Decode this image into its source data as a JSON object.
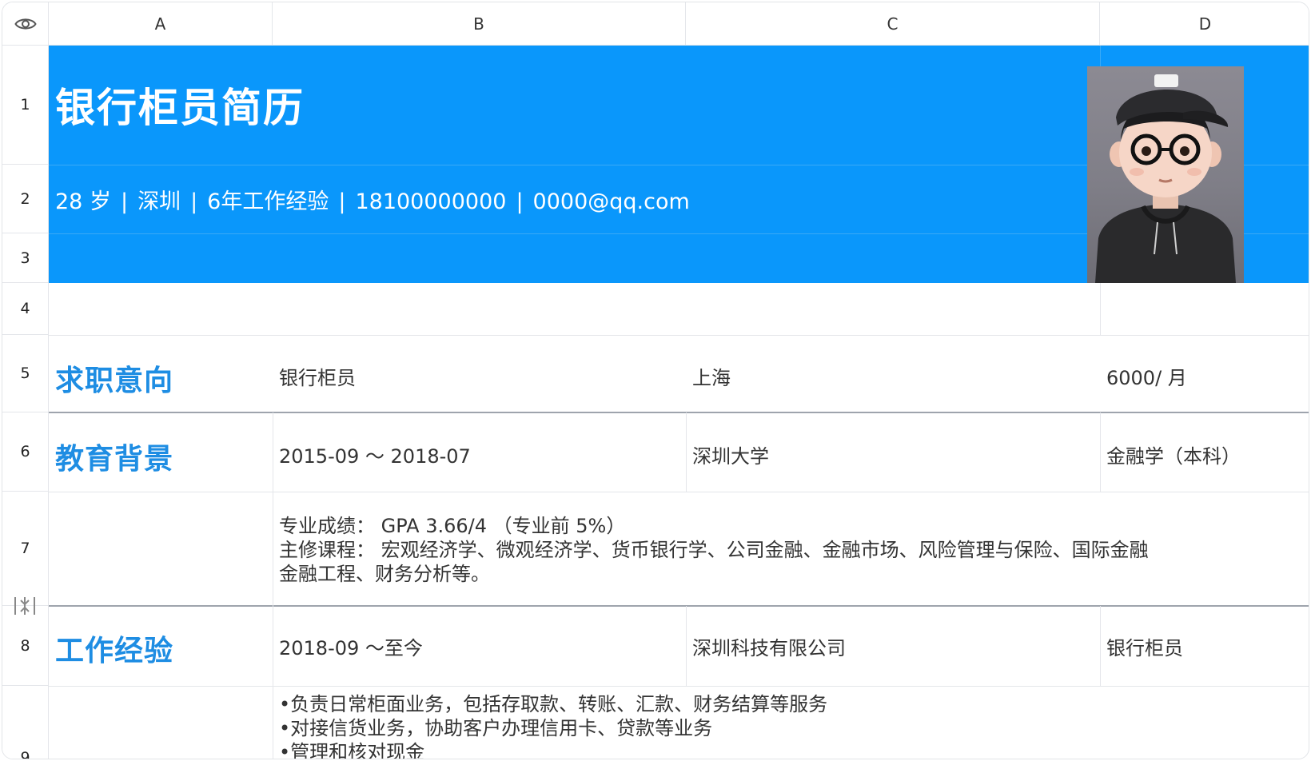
{
  "columns": [
    "A",
    "B",
    "C",
    "D"
  ],
  "rows": [
    "1",
    "2",
    "3",
    "4",
    "5",
    "6",
    "7",
    "8",
    "9"
  ],
  "header": {
    "title": "银行柜员简历",
    "info": [
      "28 岁",
      "深圳",
      "6年工作经验",
      "18100000000",
      "0000@qq.com"
    ],
    "separator": "|"
  },
  "job_intent": {
    "label": "求职意向",
    "position": "银行柜员",
    "city": "上海",
    "salary": "6000/ 月"
  },
  "education": {
    "label": "教育背景",
    "period": "2015-09 ～ 2018-07",
    "school": "深圳大学",
    "major": "金融学（本科）",
    "details": [
      "专业成绩： GPA 3.66/4 （专业前 5%）",
      "主修课程： 宏观经济学、微观经济学、货币银行学、公司金融、金融市场、风险管理与保险、国际金融",
      "金融工程、财务分析等。"
    ]
  },
  "work": {
    "label": "工作经验",
    "period": "2018-09 ～至今",
    "company": "深圳科技有限公司",
    "role": "银行柜员",
    "details": [
      "•负责日常柜面业务，包括存取款、转账、汇款、财务结算等服务",
      "•对接信货业务，协助客户办理信用卡、贷款等业务",
      "•管理和核对现金"
    ]
  },
  "colors": {
    "banner": "#0a97fb",
    "section_title": "#1e8de3",
    "text": "#333333"
  },
  "icons": {
    "visibility": "eye-icon",
    "row_resize": "row-resize-icon"
  }
}
